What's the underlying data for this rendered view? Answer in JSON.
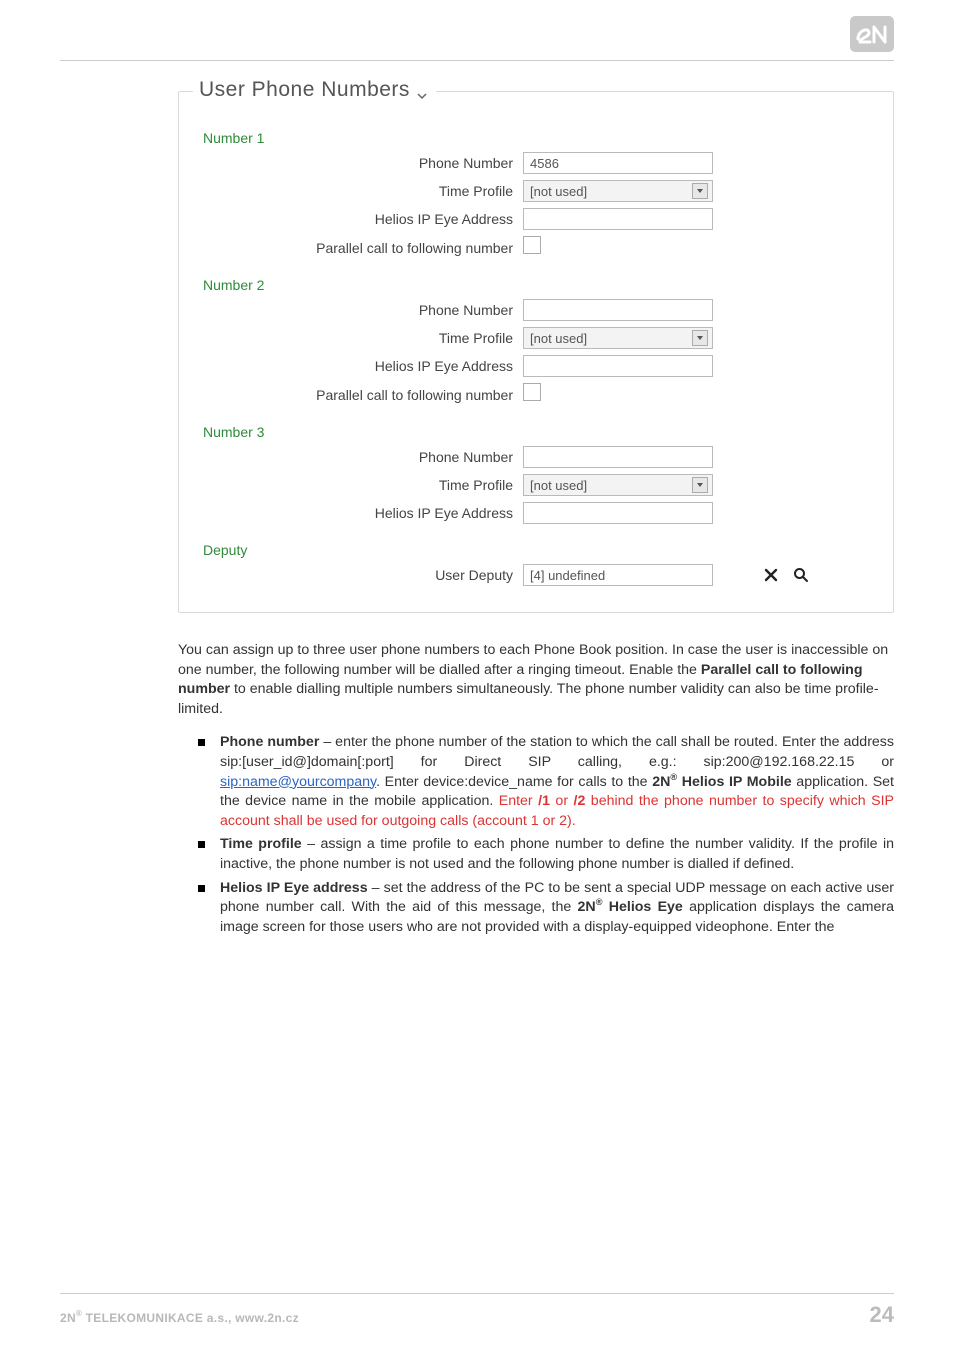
{
  "panel": {
    "title": "User Phone Numbers",
    "numbers": [
      {
        "heading": "Number 1",
        "phone_label": "Phone Number",
        "phone_value": "4586",
        "tp_label": "Time Profile",
        "tp_value": "[not used]",
        "eye_label": "Helios IP Eye Address",
        "eye_value": "",
        "par_label": "Parallel call to following number"
      },
      {
        "heading": "Number 2",
        "phone_label": "Phone Number",
        "phone_value": "",
        "tp_label": "Time Profile",
        "tp_value": "[not used]",
        "eye_label": "Helios IP Eye Address",
        "eye_value": "",
        "par_label": "Parallel call to following number"
      },
      {
        "heading": "Number 3",
        "phone_label": "Phone Number",
        "phone_value": "",
        "tp_label": "Time Profile",
        "tp_value": "[not used]",
        "eye_label": "Helios IP Eye Address",
        "eye_value": ""
      }
    ],
    "deputy": {
      "heading": "Deputy",
      "label": "User Deputy",
      "value": "[4] undefined"
    }
  },
  "body": {
    "intro_a": "You can assign up to three user phone numbers to each Phone Book position. In case the user is inaccessible on one number, the following number will be dialled after a ringing timeout. Enable the ",
    "intro_b_bold": "Parallel call to following number",
    "intro_c": " to enable dialling multiple numbers simultaneously. The phone number validity can also be time profile-limited.",
    "bullets": {
      "phone": {
        "title": "Phone number",
        "t1": " – enter the phone number of the station to which the call shall be routed. Enter the address sip:[user_id@]domain[:port] for Direct SIP calling, e.g.: sip:200@192.168.22.15 or ",
        "link": "sip:name@yourcompany",
        "t2": ". Enter device:device_name for calls to the ",
        "brand": "2N",
        "t3_bold": " Helios IP Mobile",
        "t3b": " application. Set the device name in the mobile application. ",
        "red_a": "Enter ",
        "red_b1": "/1",
        "red_mid": " or ",
        "red_b2": "/2",
        "red_c": " behind the phone number to specify which SIP account shall be used for outgoing calls (account 1 or 2)."
      },
      "time": {
        "title": "Time profile",
        "text": " – assign a time profile to each phone number to define the number validity. If the profile in inactive, the phone number is not used and the following phone number is dialled if defined."
      },
      "eye": {
        "title": "Helios IP Eye address",
        "t1": " – set the address of the PC to be sent a special UDP message on each active user phone number call. With the aid of this message, the ",
        "brand": "2N",
        "t2_bold": " Helios Eye",
        "t2b": " application displays the camera image screen for those users who are not provided with a display-equipped videophone. Enter the"
      }
    }
  },
  "footer": {
    "company_a": "2N",
    "company_b": " TELEKOMUNIKACE a.s., www.2n.cz",
    "page": "24"
  }
}
